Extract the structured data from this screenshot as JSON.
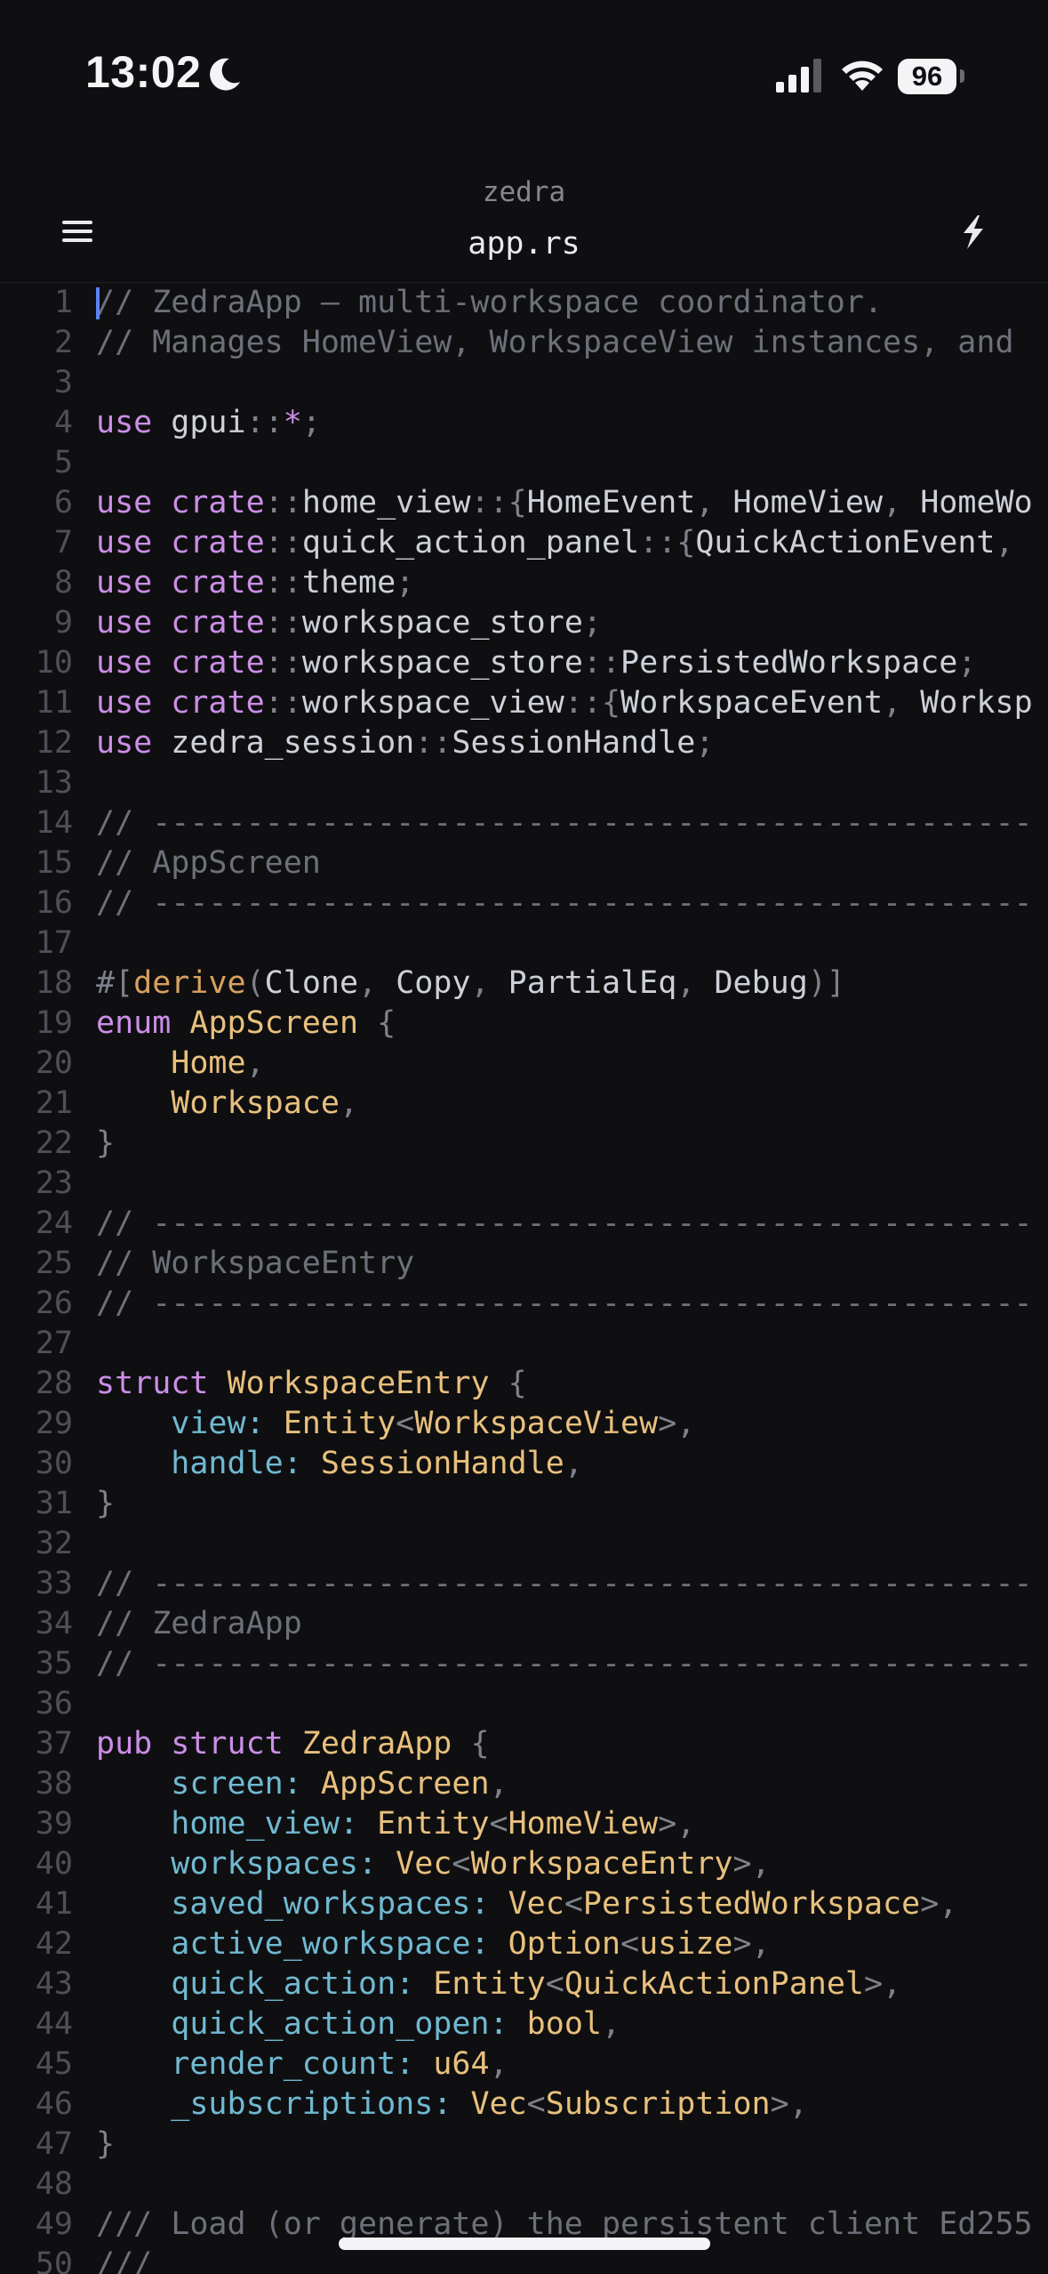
{
  "status_bar": {
    "time": "13:02",
    "battery": "96",
    "icons": [
      "moon-icon",
      "signal-bars-icon",
      "wifi-icon",
      "battery-icon"
    ]
  },
  "header": {
    "project": "zedra",
    "file": "app.rs",
    "icons": [
      "hamburger-menu-icon",
      "lightning-bolt-icon"
    ]
  },
  "editor": {
    "cursor_line": 1,
    "colors": {
      "keyword": "#cc8ee8",
      "comment": "#6c7079",
      "type": "#e8c07d",
      "field": "#70b9d2",
      "punctuation": "#7d818a",
      "attribute": "#d9a05f",
      "text": "#cdd0d8",
      "cursor": "#5b82f5",
      "background": "#0f0f11"
    },
    "lines": [
      {
        "n": "1",
        "tokens": [
          {
            "t": "// ZedraApp — multi-workspace coordinator.",
            "c": "cm"
          }
        ]
      },
      {
        "n": "2",
        "tokens": [
          {
            "t": "// Manages HomeView, WorkspaceView instances, and",
            "c": "cm"
          }
        ]
      },
      {
        "n": "3",
        "tokens": []
      },
      {
        "n": "4",
        "tokens": [
          {
            "t": "use",
            "c": "kw"
          },
          {
            "t": " gpui",
            "c": "tx"
          },
          {
            "t": "::",
            "c": "pn"
          },
          {
            "t": "*",
            "c": "kw"
          },
          {
            "t": ";",
            "c": "pn"
          }
        ]
      },
      {
        "n": "5",
        "tokens": []
      },
      {
        "n": "6",
        "tokens": [
          {
            "t": "use",
            "c": "kw"
          },
          {
            "t": " crate",
            "c": "kw"
          },
          {
            "t": "::",
            "c": "pn"
          },
          {
            "t": "home_view",
            "c": "tx"
          },
          {
            "t": "::{",
            "c": "pn"
          },
          {
            "t": "HomeEvent",
            "c": "tx"
          },
          {
            "t": ", ",
            "c": "pn"
          },
          {
            "t": "HomeView",
            "c": "tx"
          },
          {
            "t": ", ",
            "c": "pn"
          },
          {
            "t": "HomeWo",
            "c": "tx"
          }
        ]
      },
      {
        "n": "7",
        "tokens": [
          {
            "t": "use",
            "c": "kw"
          },
          {
            "t": " crate",
            "c": "kw"
          },
          {
            "t": "::",
            "c": "pn"
          },
          {
            "t": "quick_action_panel",
            "c": "tx"
          },
          {
            "t": "::{",
            "c": "pn"
          },
          {
            "t": "QuickActionEvent",
            "c": "tx"
          },
          {
            "t": ",",
            "c": "pn"
          }
        ]
      },
      {
        "n": "8",
        "tokens": [
          {
            "t": "use",
            "c": "kw"
          },
          {
            "t": " crate",
            "c": "kw"
          },
          {
            "t": "::",
            "c": "pn"
          },
          {
            "t": "theme",
            "c": "tx"
          },
          {
            "t": ";",
            "c": "pn"
          }
        ]
      },
      {
        "n": "9",
        "tokens": [
          {
            "t": "use",
            "c": "kw"
          },
          {
            "t": " crate",
            "c": "kw"
          },
          {
            "t": "::",
            "c": "pn"
          },
          {
            "t": "workspace_store",
            "c": "tx"
          },
          {
            "t": ";",
            "c": "pn"
          }
        ]
      },
      {
        "n": "10",
        "tokens": [
          {
            "t": "use",
            "c": "kw"
          },
          {
            "t": " crate",
            "c": "kw"
          },
          {
            "t": "::",
            "c": "pn"
          },
          {
            "t": "workspace_store",
            "c": "tx"
          },
          {
            "t": "::",
            "c": "pn"
          },
          {
            "t": "PersistedWorkspace",
            "c": "tx"
          },
          {
            "t": ";",
            "c": "pn"
          }
        ]
      },
      {
        "n": "11",
        "tokens": [
          {
            "t": "use",
            "c": "kw"
          },
          {
            "t": " crate",
            "c": "kw"
          },
          {
            "t": "::",
            "c": "pn"
          },
          {
            "t": "workspace_view",
            "c": "tx"
          },
          {
            "t": "::{",
            "c": "pn"
          },
          {
            "t": "WorkspaceEvent",
            "c": "tx"
          },
          {
            "t": ", ",
            "c": "pn"
          },
          {
            "t": "Worksp",
            "c": "tx"
          }
        ]
      },
      {
        "n": "12",
        "tokens": [
          {
            "t": "use",
            "c": "kw"
          },
          {
            "t": " zedra_session",
            "c": "tx"
          },
          {
            "t": "::",
            "c": "pn"
          },
          {
            "t": "SessionHandle",
            "c": "tx"
          },
          {
            "t": ";",
            "c": "pn"
          }
        ]
      },
      {
        "n": "13",
        "tokens": []
      },
      {
        "n": "14",
        "tokens": [
          {
            "t": "// -----------------------------------------------",
            "c": "cm"
          }
        ]
      },
      {
        "n": "15",
        "tokens": [
          {
            "t": "// AppScreen",
            "c": "cm"
          }
        ]
      },
      {
        "n": "16",
        "tokens": [
          {
            "t": "// -----------------------------------------------",
            "c": "cm"
          }
        ]
      },
      {
        "n": "17",
        "tokens": []
      },
      {
        "n": "18",
        "tokens": [
          {
            "t": "#[",
            "c": "pn"
          },
          {
            "t": "derive",
            "c": "df"
          },
          {
            "t": "(",
            "c": "pn"
          },
          {
            "t": "Clone",
            "c": "tx"
          },
          {
            "t": ", ",
            "c": "pn"
          },
          {
            "t": "Copy",
            "c": "tx"
          },
          {
            "t": ", ",
            "c": "pn"
          },
          {
            "t": "PartialEq",
            "c": "tx"
          },
          {
            "t": ", ",
            "c": "pn"
          },
          {
            "t": "Debug",
            "c": "tx"
          },
          {
            "t": ")]",
            "c": "pn"
          }
        ]
      },
      {
        "n": "19",
        "tokens": [
          {
            "t": "enum",
            "c": "kw"
          },
          {
            "t": " AppScreen",
            "c": "ty"
          },
          {
            "t": " {",
            "c": "pn"
          }
        ]
      },
      {
        "n": "20",
        "tokens": [
          {
            "t": "    Home",
            "c": "ty"
          },
          {
            "t": ",",
            "c": "pn"
          }
        ]
      },
      {
        "n": "21",
        "tokens": [
          {
            "t": "    Workspace",
            "c": "ty"
          },
          {
            "t": ",",
            "c": "pn"
          }
        ]
      },
      {
        "n": "22",
        "tokens": [
          {
            "t": "}",
            "c": "pn"
          }
        ]
      },
      {
        "n": "23",
        "tokens": []
      },
      {
        "n": "24",
        "tokens": [
          {
            "t": "// -----------------------------------------------",
            "c": "cm"
          }
        ]
      },
      {
        "n": "25",
        "tokens": [
          {
            "t": "// WorkspaceEntry",
            "c": "cm"
          }
        ]
      },
      {
        "n": "26",
        "tokens": [
          {
            "t": "// -----------------------------------------------",
            "c": "cm"
          }
        ]
      },
      {
        "n": "27",
        "tokens": []
      },
      {
        "n": "28",
        "tokens": [
          {
            "t": "struct",
            "c": "kw"
          },
          {
            "t": " WorkspaceEntry",
            "c": "ty"
          },
          {
            "t": " {",
            "c": "pn"
          }
        ]
      },
      {
        "n": "29",
        "tokens": [
          {
            "t": "    view",
            "c": "fd"
          },
          {
            "t": ": ",
            "c": "fd"
          },
          {
            "t": "Entity",
            "c": "ty"
          },
          {
            "t": "<",
            "c": "pn"
          },
          {
            "t": "WorkspaceView",
            "c": "ty"
          },
          {
            "t": ">,",
            "c": "pn"
          }
        ]
      },
      {
        "n": "30",
        "tokens": [
          {
            "t": "    handle",
            "c": "fd"
          },
          {
            "t": ": ",
            "c": "fd"
          },
          {
            "t": "SessionHandle",
            "c": "ty"
          },
          {
            "t": ",",
            "c": "pn"
          }
        ]
      },
      {
        "n": "31",
        "tokens": [
          {
            "t": "}",
            "c": "pn"
          }
        ]
      },
      {
        "n": "32",
        "tokens": []
      },
      {
        "n": "33",
        "tokens": [
          {
            "t": "// -----------------------------------------------",
            "c": "cm"
          }
        ]
      },
      {
        "n": "34",
        "tokens": [
          {
            "t": "// ZedraApp",
            "c": "cm"
          }
        ]
      },
      {
        "n": "35",
        "tokens": [
          {
            "t": "// -----------------------------------------------",
            "c": "cm"
          }
        ]
      },
      {
        "n": "36",
        "tokens": []
      },
      {
        "n": "37",
        "tokens": [
          {
            "t": "pub",
            "c": "kw"
          },
          {
            "t": " struct",
            "c": "kw"
          },
          {
            "t": " ZedraApp",
            "c": "ty"
          },
          {
            "t": " {",
            "c": "pn"
          }
        ]
      },
      {
        "n": "38",
        "tokens": [
          {
            "t": "    screen",
            "c": "fd"
          },
          {
            "t": ": ",
            "c": "fd"
          },
          {
            "t": "AppScreen",
            "c": "ty"
          },
          {
            "t": ",",
            "c": "pn"
          }
        ]
      },
      {
        "n": "39",
        "tokens": [
          {
            "t": "    home_view",
            "c": "fd"
          },
          {
            "t": ": ",
            "c": "fd"
          },
          {
            "t": "Entity",
            "c": "ty"
          },
          {
            "t": "<",
            "c": "pn"
          },
          {
            "t": "HomeView",
            "c": "ty"
          },
          {
            "t": ">,",
            "c": "pn"
          }
        ]
      },
      {
        "n": "40",
        "tokens": [
          {
            "t": "    workspaces",
            "c": "fd"
          },
          {
            "t": ": ",
            "c": "fd"
          },
          {
            "t": "Vec",
            "c": "ty"
          },
          {
            "t": "<",
            "c": "pn"
          },
          {
            "t": "WorkspaceEntry",
            "c": "ty"
          },
          {
            "t": ">,",
            "c": "pn"
          }
        ]
      },
      {
        "n": "41",
        "tokens": [
          {
            "t": "    saved_workspaces",
            "c": "fd"
          },
          {
            "t": ": ",
            "c": "fd"
          },
          {
            "t": "Vec",
            "c": "ty"
          },
          {
            "t": "<",
            "c": "pn"
          },
          {
            "t": "PersistedWorkspace",
            "c": "ty"
          },
          {
            "t": ">,",
            "c": "pn"
          }
        ]
      },
      {
        "n": "42",
        "tokens": [
          {
            "t": "    active_workspace",
            "c": "fd"
          },
          {
            "t": ": ",
            "c": "fd"
          },
          {
            "t": "Option",
            "c": "ty"
          },
          {
            "t": "<",
            "c": "pn"
          },
          {
            "t": "usize",
            "c": "ty"
          },
          {
            "t": ">,",
            "c": "pn"
          }
        ]
      },
      {
        "n": "43",
        "tokens": [
          {
            "t": "    quick_action",
            "c": "fd"
          },
          {
            "t": ": ",
            "c": "fd"
          },
          {
            "t": "Entity",
            "c": "ty"
          },
          {
            "t": "<",
            "c": "pn"
          },
          {
            "t": "QuickActionPanel",
            "c": "ty"
          },
          {
            "t": ">,",
            "c": "pn"
          }
        ]
      },
      {
        "n": "44",
        "tokens": [
          {
            "t": "    quick_action_open",
            "c": "fd"
          },
          {
            "t": ": ",
            "c": "fd"
          },
          {
            "t": "bool",
            "c": "ty"
          },
          {
            "t": ",",
            "c": "pn"
          }
        ]
      },
      {
        "n": "45",
        "tokens": [
          {
            "t": "    render_count",
            "c": "fd"
          },
          {
            "t": ": ",
            "c": "fd"
          },
          {
            "t": "u64",
            "c": "ty"
          },
          {
            "t": ",",
            "c": "pn"
          }
        ]
      },
      {
        "n": "46",
        "tokens": [
          {
            "t": "    _subscriptions",
            "c": "fd"
          },
          {
            "t": ": ",
            "c": "fd"
          },
          {
            "t": "Vec",
            "c": "ty"
          },
          {
            "t": "<",
            "c": "pn"
          },
          {
            "t": "Subscription",
            "c": "ty"
          },
          {
            "t": ">,",
            "c": "pn"
          }
        ]
      },
      {
        "n": "47",
        "tokens": [
          {
            "t": "}",
            "c": "pn"
          }
        ]
      },
      {
        "n": "48",
        "tokens": []
      },
      {
        "n": "49",
        "tokens": [
          {
            "t": "/// Load (or generate) the persistent client Ed255",
            "c": "cm"
          }
        ]
      },
      {
        "n": "50",
        "tokens": [
          {
            "t": "///",
            "c": "cm"
          }
        ]
      }
    ]
  }
}
